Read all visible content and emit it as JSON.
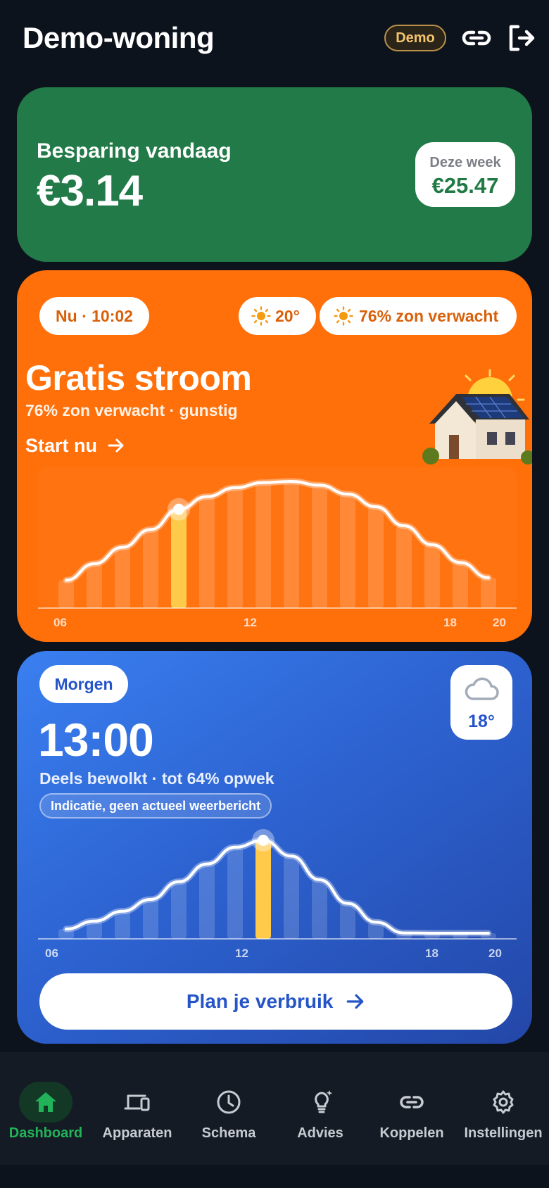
{
  "header": {
    "title": "Demo-woning",
    "badge": "Demo",
    "icons": [
      "link-icon",
      "logout-icon"
    ]
  },
  "savings": {
    "label": "Besparing vandaag",
    "value": "€3.14",
    "week_label": "Deze week",
    "week_value": "€25.47"
  },
  "today": {
    "now_pill": "Nu · 10:02",
    "temp": "20°",
    "sun_forecast": "76% zon verwacht",
    "headline": "Gratis stroom",
    "subtitle": "76% zon verwacht · gunstig",
    "action": "Start nu",
    "chart": {
      "x_ticks": [
        "06",
        "12",
        "18",
        "20"
      ],
      "bars": [
        0.22,
        0.35,
        0.48,
        0.62,
        0.78,
        0.88,
        0.95,
        0.99,
        1.0,
        0.97,
        0.9,
        0.8,
        0.65,
        0.5,
        0.36,
        0.24
      ],
      "highlight_index": 4
    }
  },
  "tomorrow": {
    "day": "Morgen",
    "weather_icon": "cloud-icon",
    "weather_temp": "18°",
    "time": "13:00",
    "subtitle": "Deels bewolkt · tot 64% opwek",
    "hint": "Indicatie, geen actueel weerbericht",
    "chart": {
      "x_ticks": [
        "06",
        "12",
        "18",
        "20"
      ],
      "bars": [
        0.1,
        0.18,
        0.28,
        0.4,
        0.58,
        0.76,
        0.93,
        1.0,
        0.84,
        0.6,
        0.36,
        0.17,
        0.06,
        0.02,
        0.0,
        0.0
      ],
      "highlight_index": 7
    },
    "button": "Plan je verbruik"
  },
  "nav": [
    {
      "label": "Dashboard",
      "icon": "home-icon",
      "active": true
    },
    {
      "label": "Apparaten",
      "icon": "devices-icon",
      "active": false
    },
    {
      "label": "Schema",
      "icon": "clock-icon",
      "active": false
    },
    {
      "label": "Advies",
      "icon": "lightbulb-icon",
      "active": false
    },
    {
      "label": "Koppelen",
      "icon": "link-icon",
      "active": false
    },
    {
      "label": "Instellingen",
      "icon": "gear-icon",
      "active": false
    }
  ],
  "colors": {
    "background": "#0d131c",
    "savings": "#217a47",
    "today": "#ff6f0a",
    "tomorrow": "#2d63d1",
    "highlight": "#ffc94a",
    "nav_active": "#22b35a"
  }
}
